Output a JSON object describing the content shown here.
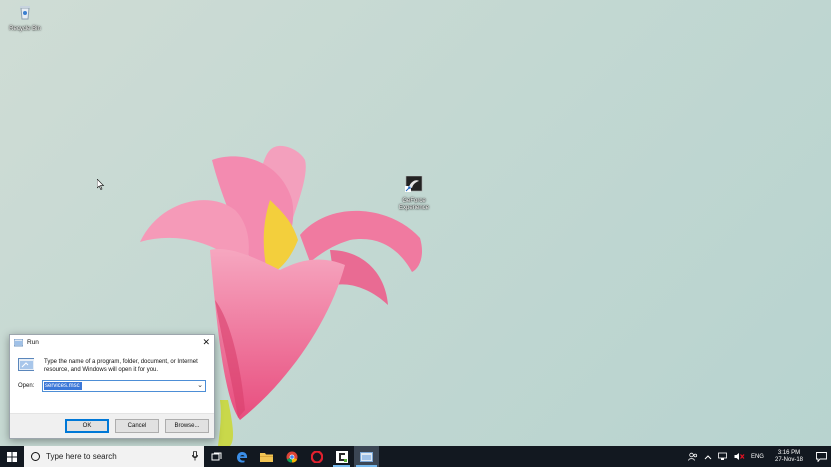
{
  "desktop": {
    "icons": [
      {
        "label": "Recycle Bin"
      },
      {
        "label": "GeForce Experience"
      }
    ]
  },
  "run_dialog": {
    "title": "Run",
    "description": "Type the name of a program, folder, document, or Internet resource, and Windows will open it for you.",
    "open_label": "Open:",
    "open_value": "services.msc",
    "buttons": {
      "ok": "OK",
      "cancel": "Cancel",
      "browse": "Browse..."
    }
  },
  "taskbar": {
    "search_placeholder": "Type here to search",
    "apps": [
      "task-view",
      "edge",
      "file-explorer",
      "chrome",
      "opera",
      "camtasia",
      "run"
    ],
    "tray": {
      "language": "ENG",
      "time": "3:16 PM",
      "date": "27-Nov-18"
    }
  },
  "colors": {
    "taskbar": "#121820",
    "accent": "#0078d7",
    "wallpaper": "#c3d8d2",
    "flower": "#f07aa0"
  }
}
